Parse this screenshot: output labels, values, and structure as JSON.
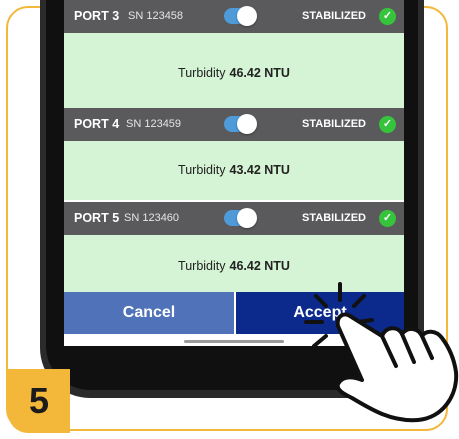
{
  "ports": [
    {
      "name": "PORT 3",
      "sn": "SN 123458",
      "status": "STABILIZED",
      "reading_label": "Turbidity",
      "reading_value": "46.42 NTU",
      "toggle_on": true
    },
    {
      "name": "PORT 4",
      "sn": "SN 123459",
      "status": "STABILIZED",
      "reading_label": "Turbidity",
      "reading_value": "43.42 NTU",
      "toggle_on": true
    },
    {
      "name": "PORT 5",
      "sn": "SN 123460",
      "status": "STABILIZED",
      "reading_label": "Turbidity",
      "reading_value": "46.42 NTU",
      "toggle_on": true
    }
  ],
  "buttons": {
    "cancel": "Cancel",
    "accept": "Accept"
  },
  "step_number": "5",
  "colors": {
    "frame": "#f3b73a",
    "header": "#5a5a5c",
    "reading_bg": "#d5f3d5",
    "toggle": "#4f9bd9",
    "check": "#35c43b",
    "cancel": "#4f72b8",
    "accept": "#0b2a8c"
  },
  "icons": {
    "status": "check-circle-icon",
    "pointer": "tapping-hand-icon"
  }
}
